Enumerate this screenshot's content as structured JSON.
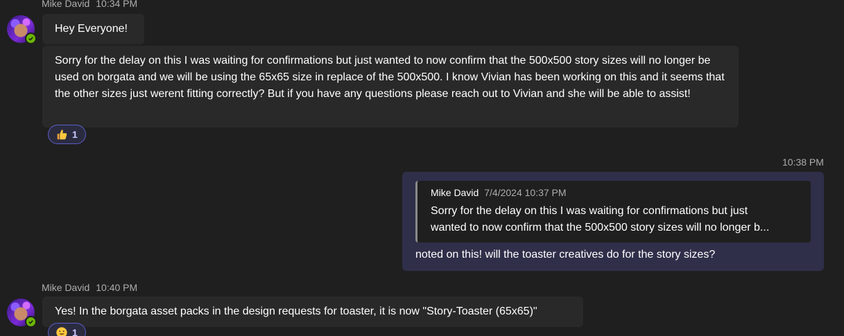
{
  "messages": [
    {
      "sender": "Mike David",
      "time": "10:34 PM",
      "bubbles": [
        "Hey Everyone!",
        "Sorry for the delay on this I was waiting for confirmations but just wanted to now confirm that the 500x500 story sizes will no longer be used on borgata and we will be using the 65x65 size in replace of the 500x500. I know Vivian has been working on this and it seems that the other sizes just werent fitting correctly? But if you have any questions please reach out to Vivian and she will be able to assist!"
      ],
      "reaction": {
        "emoji": "thumbs-up",
        "count": "1"
      }
    },
    {
      "time": "10:38 PM",
      "quote": {
        "sender": "Mike David",
        "time": "7/4/2024 10:37 PM",
        "line1": "Sorry for the delay on this I was waiting for confirmations but just",
        "line2": "wanted to now confirm that the 500x500 story sizes will no longer b..."
      },
      "text": "noted on this! will the toaster creatives do for the story sizes?"
    },
    {
      "sender": "Mike David",
      "time": "10:40 PM",
      "text": "Yes! In the borgata asset packs in the design requests for toaster, it is now \"Story-Toaster (65x65)\"",
      "reaction": {
        "emoji": "grinning-face",
        "count": "1"
      }
    }
  ],
  "colors": {
    "background": "#1f1f1f",
    "bubble": "#292929",
    "my_bubble": "#2f2f4a",
    "accent": "#5b5fc7",
    "presence": "#6bb700"
  }
}
